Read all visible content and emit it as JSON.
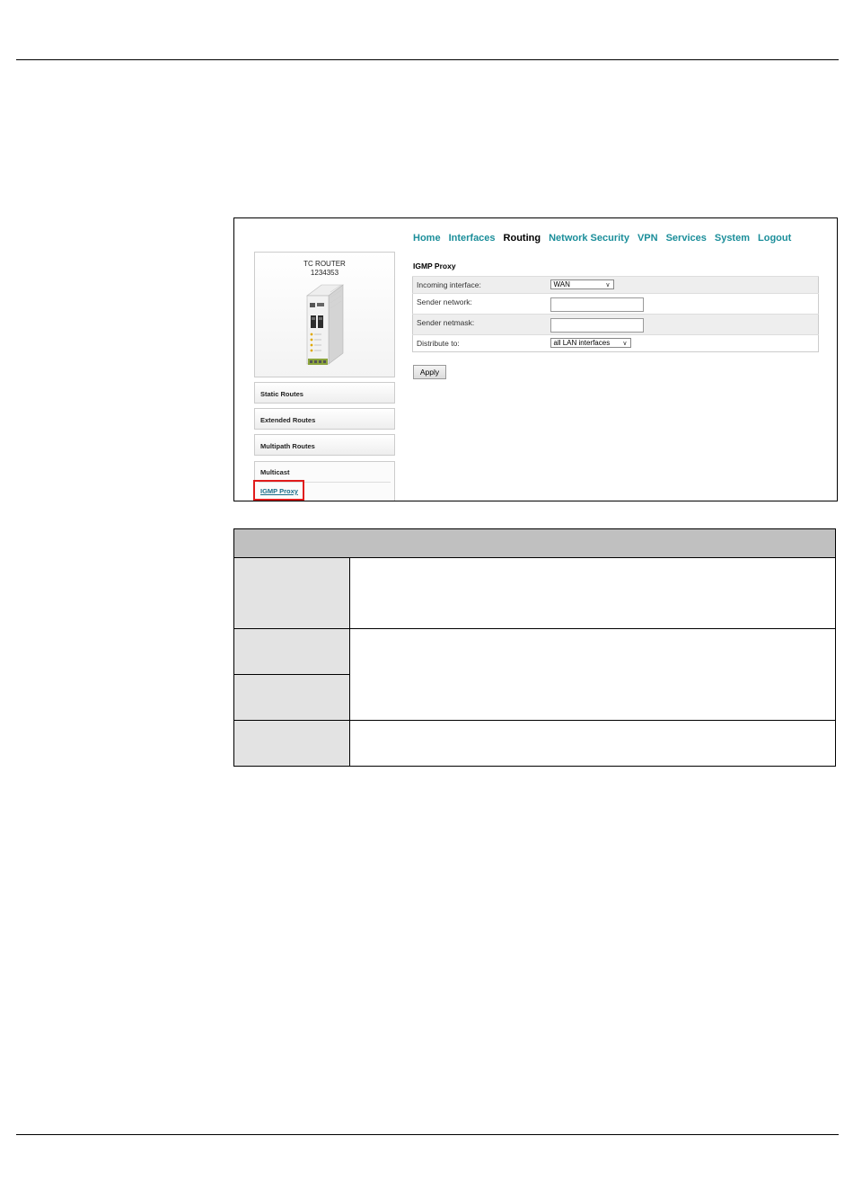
{
  "nav": {
    "items": [
      {
        "label": "Home",
        "active": false
      },
      {
        "label": "Interfaces",
        "active": false
      },
      {
        "label": "Routing",
        "active": true
      },
      {
        "label": "Network Security",
        "active": false
      },
      {
        "label": "VPN",
        "active": false
      },
      {
        "label": "Services",
        "active": false
      },
      {
        "label": "System",
        "active": false
      },
      {
        "label": "Logout",
        "active": false
      }
    ],
    "link_color": "#1b8e9a"
  },
  "device": {
    "name": "TC ROUTER",
    "number": "1234353"
  },
  "sidebar": {
    "items": [
      {
        "label": "Static Routes"
      },
      {
        "label": "Extended Routes"
      },
      {
        "label": "Multipath Routes"
      }
    ],
    "multicast": {
      "title": "Multicast",
      "selected_link": "IGMP Proxy"
    }
  },
  "main": {
    "title": "IGMP Proxy",
    "fields": [
      {
        "label": "Incoming interface:",
        "type": "select",
        "value": "WAN"
      },
      {
        "label": "Sender network:",
        "type": "text",
        "value": ""
      },
      {
        "label": "Sender netmask:",
        "type": "text",
        "value": ""
      },
      {
        "label": "Distribute to:",
        "type": "select",
        "value": "all LAN interfaces"
      }
    ],
    "apply_label": "Apply"
  },
  "highlight_color": "#e01b1b"
}
